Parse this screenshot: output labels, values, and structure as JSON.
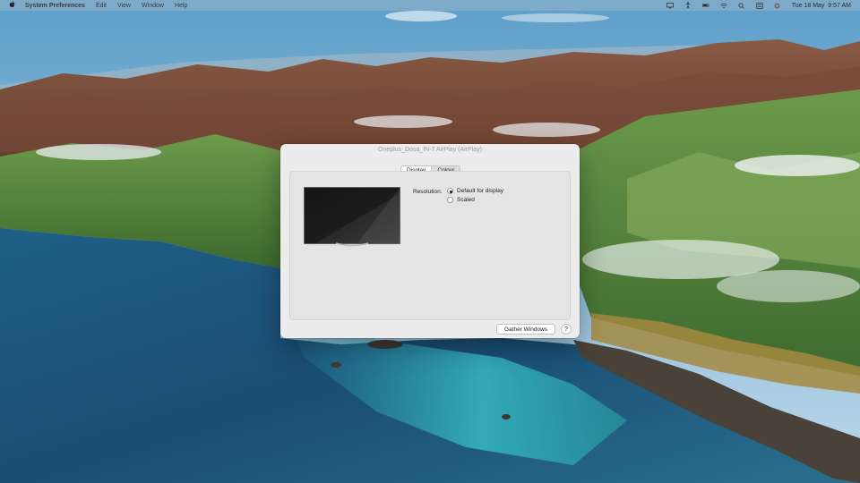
{
  "menubar": {
    "apple_icon": "apple-logo",
    "app_name": "System Preferences",
    "items": [
      "Edit",
      "View",
      "Window",
      "Help"
    ],
    "status_icons": [
      "display-icon",
      "accessibility-icon",
      "battery-icon",
      "wifi-icon",
      "search-icon",
      "control-center-icon",
      "siri-icon"
    ],
    "datetime": "Tue 18 May  9:57 AM"
  },
  "window": {
    "title": "Oneplus_Dosa_IN-7 AirPlay (AirPlay)",
    "tabs": [
      {
        "label": "Display",
        "active": true
      },
      {
        "label": "Colour",
        "active": false
      }
    ],
    "resolution": {
      "label": "Resolution:",
      "options": [
        {
          "label": "Default for display",
          "checked": true
        },
        {
          "label": "Scaled",
          "checked": false
        }
      ]
    },
    "gather_windows_label": "Gather Windows",
    "help_label": "?"
  },
  "colors": {
    "window_bg": "#ececec",
    "panel_bg": "#e4e4e4",
    "menubar_bg": "#96b4c8"
  }
}
